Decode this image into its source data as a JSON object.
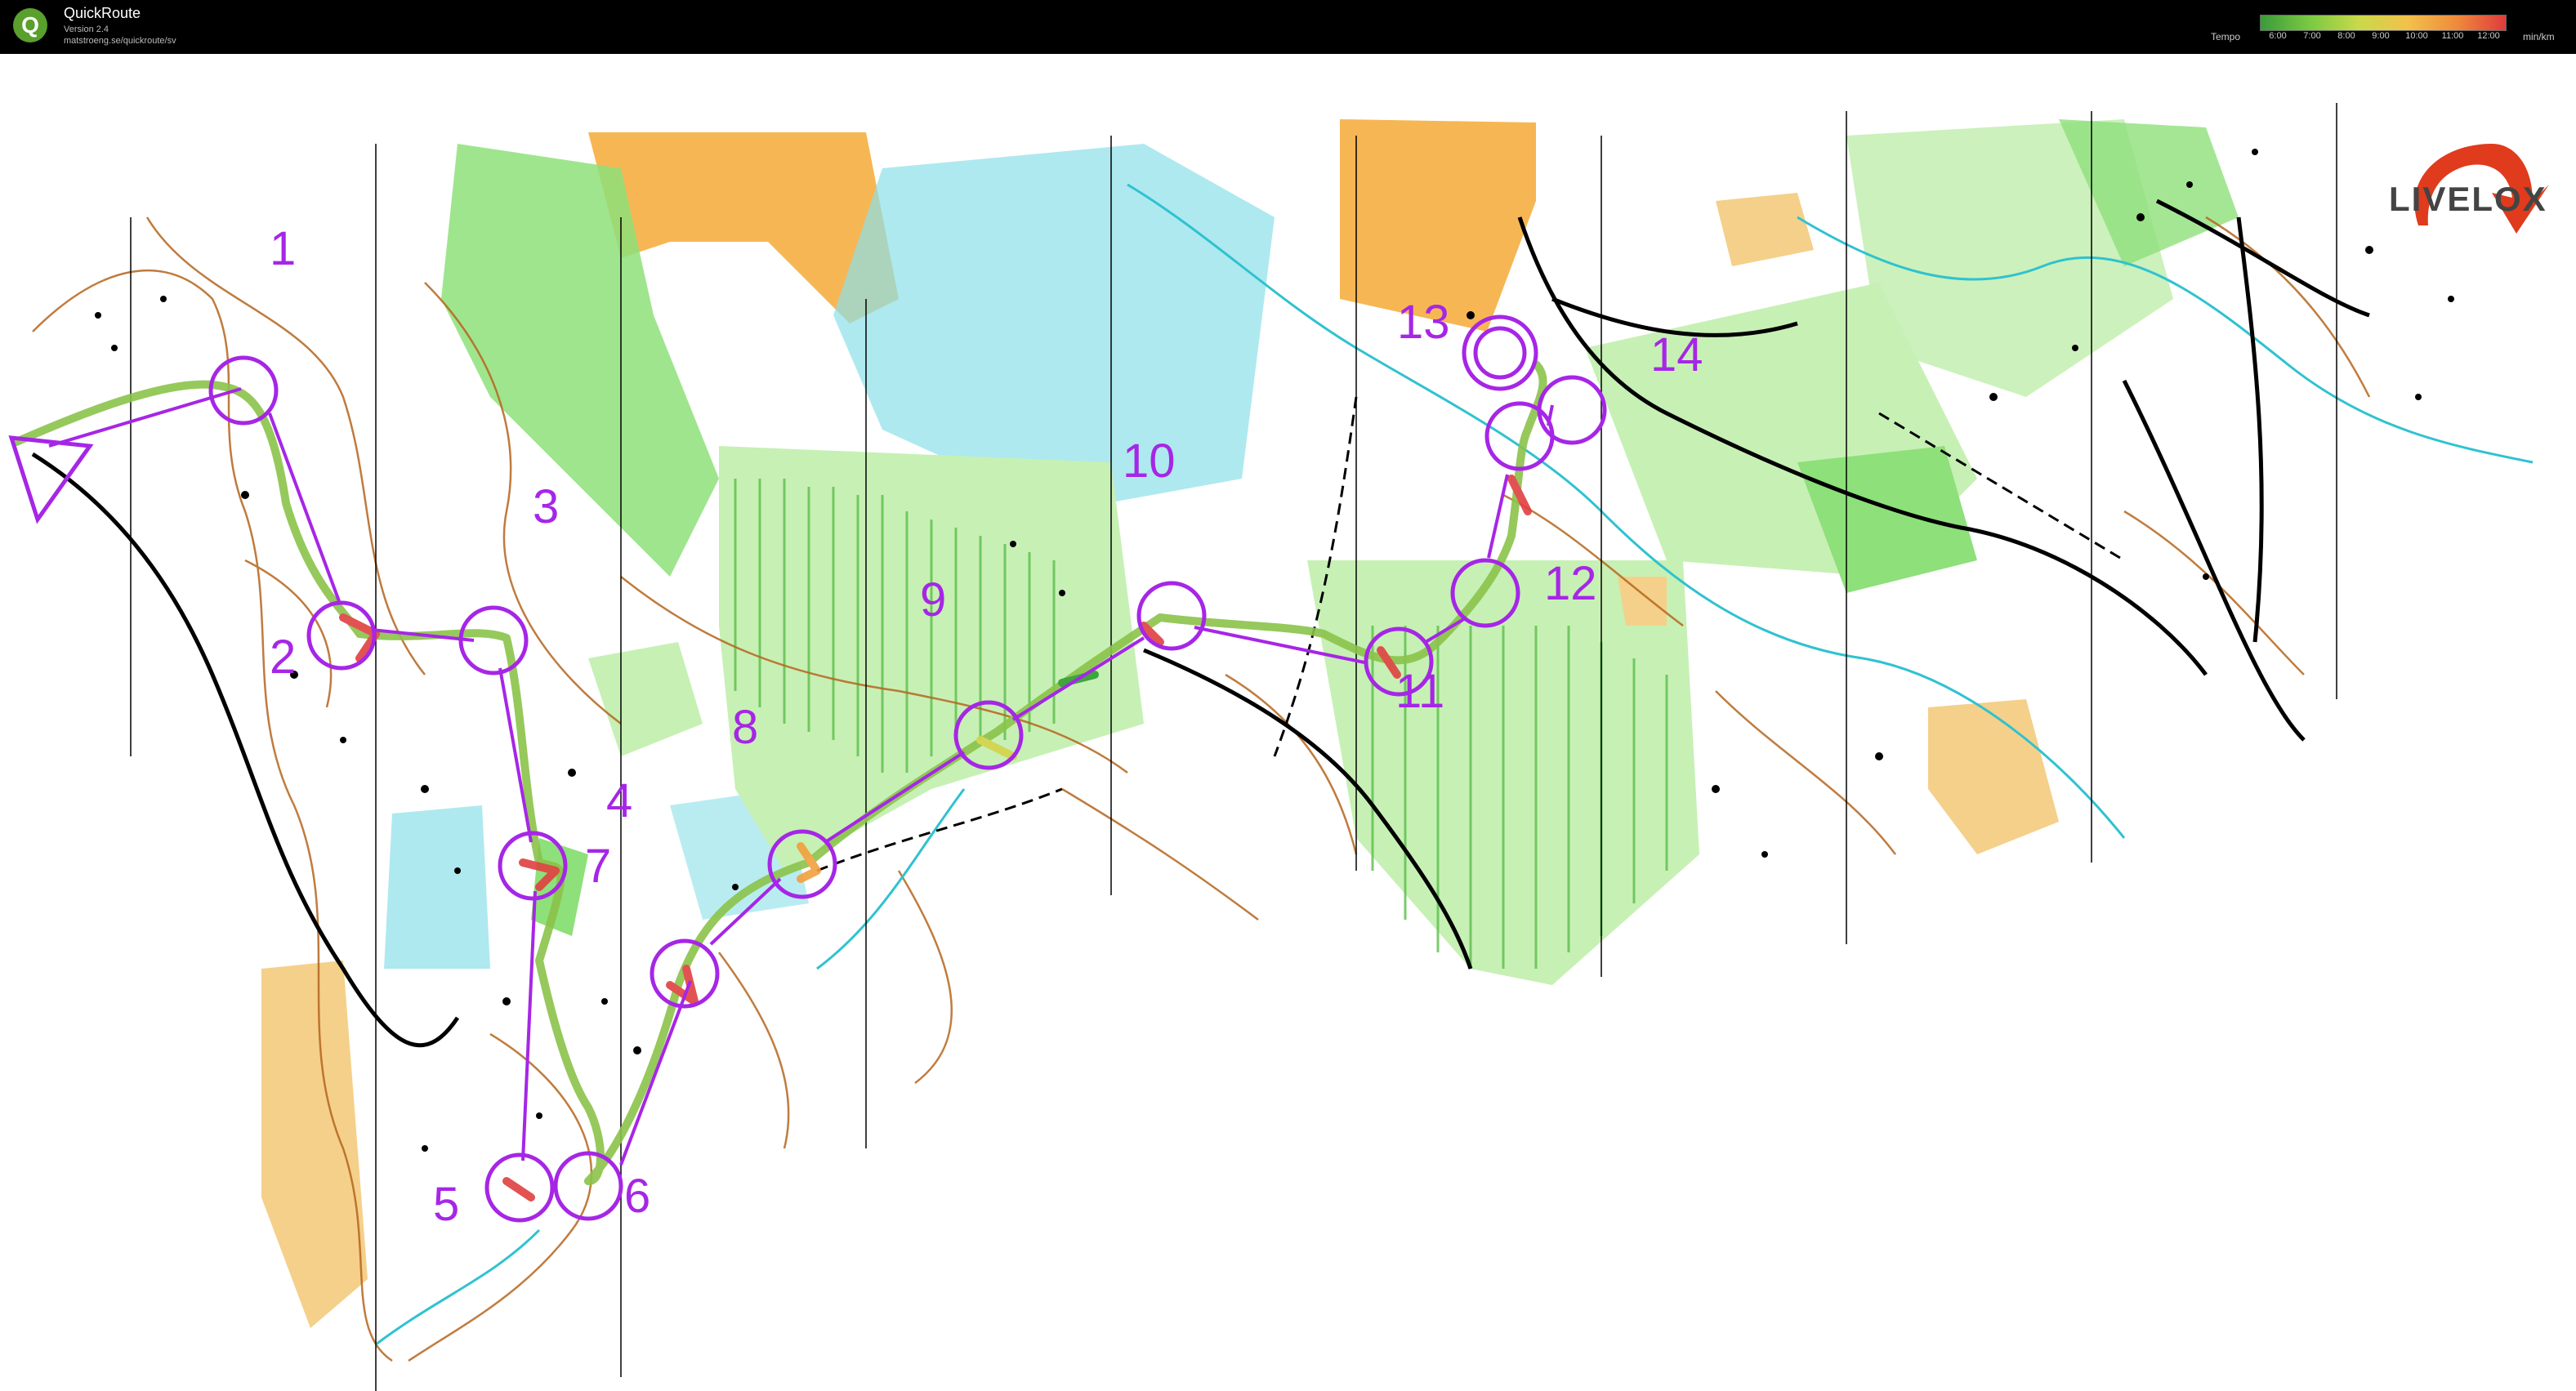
{
  "app": {
    "title": "QuickRoute",
    "version": "Version 2.4",
    "url": "matstroeng.se/quickroute/sv"
  },
  "tempo": {
    "label": "Tempo",
    "ticks": [
      "6:00",
      "7:00",
      "8:00",
      "9:00",
      "10:00",
      "11:00",
      "12:00"
    ],
    "unit": "min/km",
    "colors": [
      "#3a9b3a",
      "#7ac943",
      "#c9d94a",
      "#f2c14a",
      "#ef8a3c",
      "#e03b3b"
    ]
  },
  "branding": {
    "livelox": "LIVELOX",
    "arrow_color": "#e03b1d"
  },
  "course": {
    "color": "#a626e6",
    "controls": [
      "1",
      "2",
      "3",
      "4",
      "5",
      "6",
      "7",
      "8",
      "9",
      "10",
      "11",
      "12",
      "13",
      "14"
    ]
  },
  "route": {
    "colors": [
      "#2f9e2f",
      "#8bc34a",
      "#d4d44a",
      "#f2a03c",
      "#e04040"
    ]
  },
  "map_colors": {
    "open_land": "#f7b654",
    "green": "#8ee07a",
    "light_green": "#c7f0b5",
    "water": "#5bc9d6",
    "contour": "#b5651d",
    "track": "#000000",
    "rough": "#f5d08a"
  }
}
